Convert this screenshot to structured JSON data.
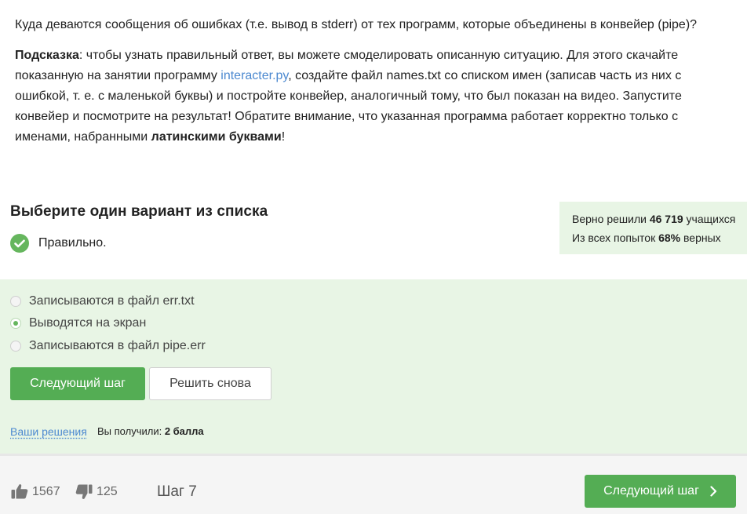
{
  "question": {
    "text": "Куда деваются сообщения об ошибках (т.е. вывод в stderr) от тех программ, которые объединены в конвейер (pipe)?",
    "hint_label": "Подсказка",
    "hint_part1": ": чтобы узнать правильный ответ, вы можете смоделировать описанную ситуацию. Для этого скачайте показанную на занятии программу ",
    "hint_link": "interacter.py",
    "hint_part2": ", создайте файл names.txt со списком имен (записав часть из них с ошибкой, т. е. с маленькой буквы) и постройте конвейер, аналогичный тому, что был показан на видео. Запустите конвейер и посмотрите на результат! Обратите внимание, что указанная программа работает корректно только с именами, набранными ",
    "hint_bold": "латинскими буквами",
    "hint_end": "!"
  },
  "quiz": {
    "title": "Выберите один вариант из списка",
    "result": "Правильно.",
    "options": [
      {
        "label": "Записываются в файл err.txt",
        "selected": false
      },
      {
        "label": "Выводятся на экран",
        "selected": true
      },
      {
        "label": "Записываются в файл pipe.err",
        "selected": false
      }
    ],
    "next_button": "Следующий шаг",
    "retry_button": "Решить снова",
    "solutions_link": "Ваши решения",
    "score_prefix": "Вы получили: ",
    "score_value": "2 балла"
  },
  "stats": {
    "solved_prefix": "Верно решили ",
    "solved_count": "46 719",
    "solved_suffix": " учащихся",
    "attempts_prefix": "Из всех попыток ",
    "attempts_percent": "68%",
    "attempts_suffix": " верных"
  },
  "footer": {
    "likes": "1567",
    "dislikes": "125",
    "step": "Шаг 7",
    "next_button": "Следующий шаг"
  },
  "colors": {
    "accent_green": "#54ad54",
    "panel_green": "#e8f5e5",
    "link_blue": "#4c89d0"
  },
  "icons": [
    "check-circle-icon",
    "radio-icon",
    "thumbs-up-icon",
    "thumbs-down-icon",
    "chevron-right-icon"
  ]
}
